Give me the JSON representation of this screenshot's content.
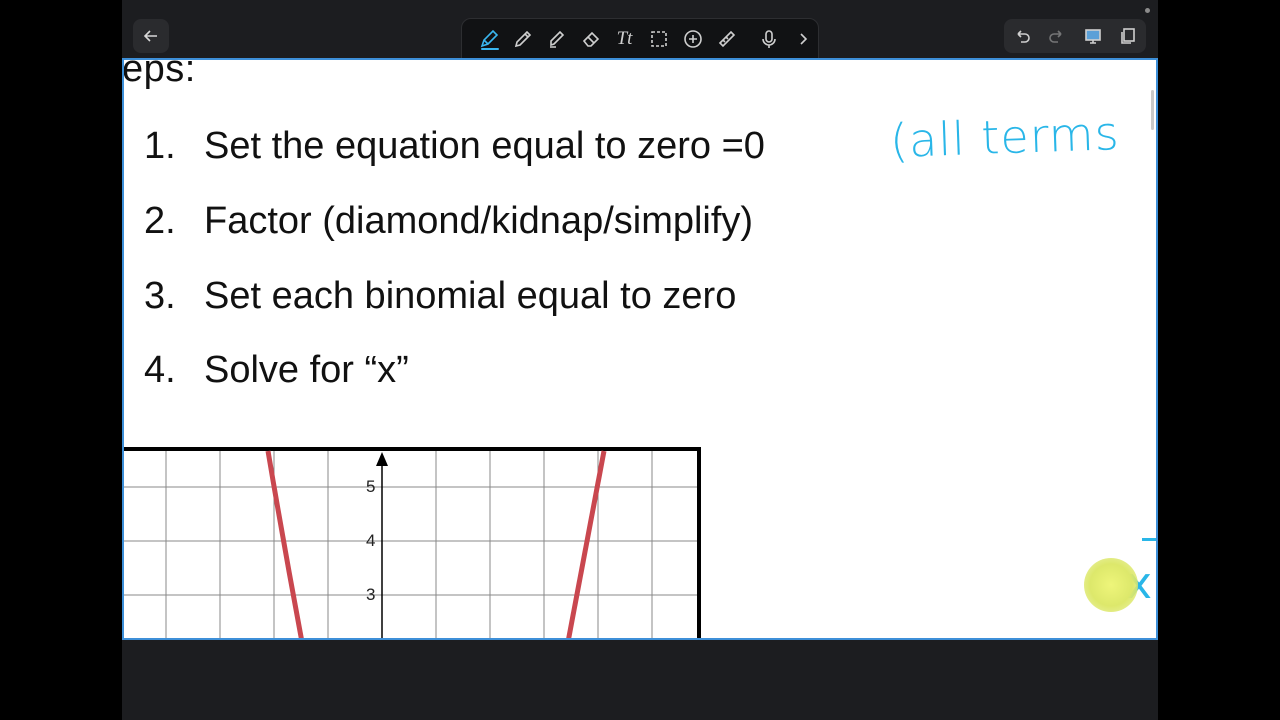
{
  "app": {
    "accent": "#3ab7f0",
    "toolbar": {
      "tools": [
        {
          "name": "pen-icon"
        },
        {
          "name": "pencil-icon"
        },
        {
          "name": "highlighter-icon"
        },
        {
          "name": "eraser-icon"
        },
        {
          "name": "text-icon",
          "label": "Tt"
        },
        {
          "name": "lasso-select-icon"
        },
        {
          "name": "add-icon"
        },
        {
          "name": "ruler-icon"
        },
        {
          "name": "microphone-icon"
        },
        {
          "name": "chevron-right-icon"
        }
      ],
      "colors": [
        "#000000",
        "#3ab7f0",
        "#e85a5e",
        "#c93ee6",
        "#ee3ec6",
        "#4cc04a",
        "#f39c12",
        "#ffffff"
      ]
    }
  },
  "page": {
    "heading": "eps:",
    "steps": [
      {
        "num": "1.",
        "text": "Set the equation equal to zero =0"
      },
      {
        "num": "2.",
        "text": "Factor (diamond/kidnap/simplify)"
      },
      {
        "num": "3.",
        "text": "Set each binomial equal to zero"
      },
      {
        "num": "4.",
        "text": "Solve for “x”"
      }
    ],
    "handwriting": {
      "note": "(all terms",
      "partial": "x"
    },
    "graph": {
      "y_ticks": [
        "5",
        "4",
        "3"
      ]
    }
  }
}
